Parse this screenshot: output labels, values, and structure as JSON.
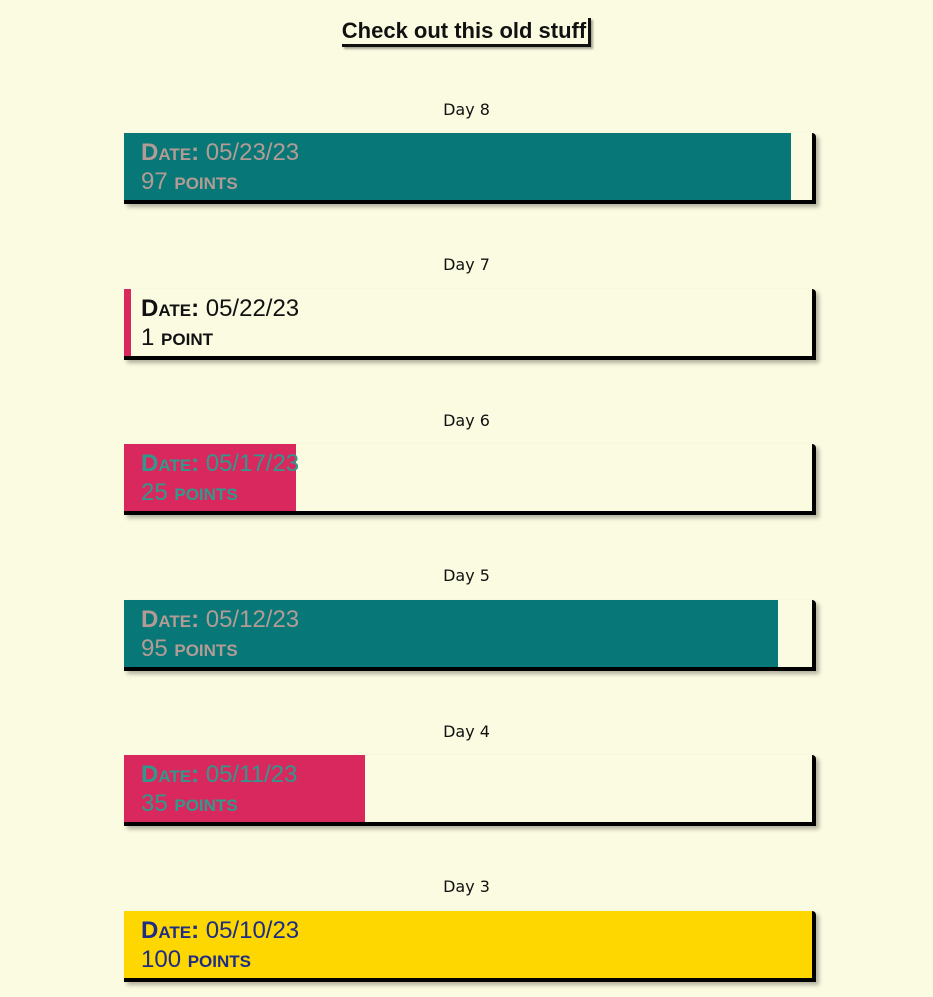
{
  "page_title": "Check out this old stuff",
  "entries": [
    {
      "day": "Day 8",
      "date_prefix": "Date:",
      "date": "05/23/23",
      "points": "97",
      "points_word": "points",
      "fill_percent": 97,
      "fill_color": "#077877",
      "text_color": "#b39b95"
    },
    {
      "day": "Day 7",
      "date_prefix": "Date:",
      "date": "05/22/23",
      "points": "1",
      "points_word": "point",
      "fill_percent": 1,
      "fill_color": "#d9285e",
      "text_color": "#111111"
    },
    {
      "day": "Day 6",
      "date_prefix": "Date:",
      "date": "05/17/23",
      "points": "25",
      "points_word": "points",
      "fill_percent": 25,
      "fill_color": "#d9285e",
      "text_color": "#2f9a8c"
    },
    {
      "day": "Day 5",
      "date_prefix": "Date:",
      "date": "05/12/23",
      "points": "95",
      "points_word": "points",
      "fill_percent": 95,
      "fill_color": "#077877",
      "text_color": "#b39b95"
    },
    {
      "day": "Day 4",
      "date_prefix": "Date:",
      "date": "05/11/23",
      "points": "35",
      "points_word": "points",
      "fill_percent": 35,
      "fill_color": "#d9285e",
      "text_color": "#2f9a8c"
    },
    {
      "day": "Day 3",
      "date_prefix": "Date:",
      "date": "05/10/23",
      "points": "100",
      "points_word": "points",
      "fill_percent": 100,
      "fill_color": "#fed700",
      "text_color": "#1e2c86"
    }
  ]
}
